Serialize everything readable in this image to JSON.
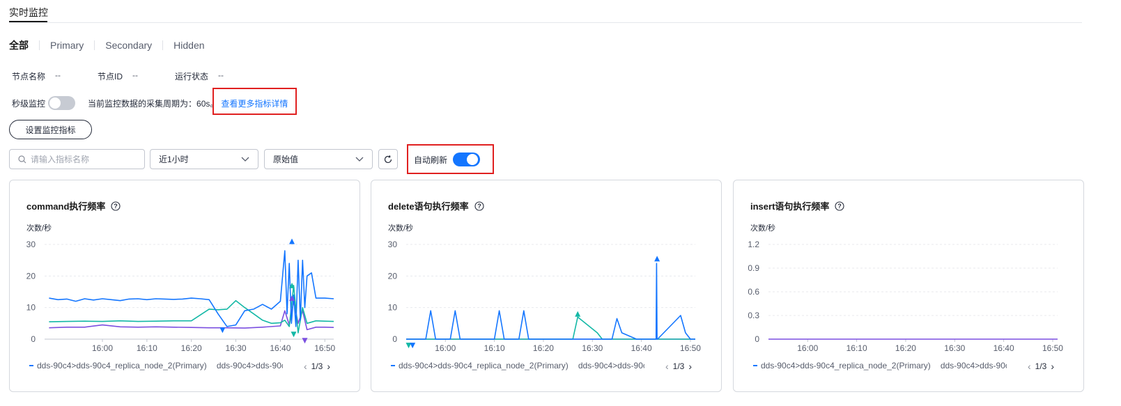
{
  "page": {
    "tab_label": "实时监控"
  },
  "role_tabs": [
    "全部",
    "Primary",
    "Secondary",
    "Hidden"
  ],
  "node_info": [
    {
      "label": "节点名称",
      "value": "--"
    },
    {
      "label": "节点ID",
      "value": "--"
    },
    {
      "label": "运行状态",
      "value": "--"
    }
  ],
  "second_monitor": {
    "label": "秒级监控",
    "enabled": false,
    "desc": "当前监控数据的采集周期为：60s。",
    "link": "查看更多指标详情"
  },
  "toolbar": {
    "setting_button": "设置监控指标",
    "search_placeholder": "请输入指标名称",
    "time_range": "近1小时",
    "value_type": "原始值",
    "auto_refresh_label": "自动刷新",
    "auto_refresh_enabled": true
  },
  "icons": {
    "search": "search-icon",
    "chevron": "chevron-down-icon",
    "refresh": "refresh-icon",
    "help": "help-circle-icon"
  },
  "colors": {
    "accent": "#1476ff",
    "series1": "#1476ff",
    "series2": "#14b8a6",
    "series3": "#7b4fe0"
  },
  "legend": {
    "series1": "dds-90c4>dds-90c4_replica_node_2(Primary)",
    "series2": "dds-90c4>dds-90c",
    "page": "1/3"
  },
  "cards": [
    {
      "title": "command执行频率",
      "unit": "次数/秒",
      "chart_data": {
        "type": "line",
        "x_ticks": [
          "16:00",
          "16:10",
          "16:20",
          "16:30",
          "16:40",
          "16:50"
        ],
        "y_ticks": [
          "30",
          "20",
          "10",
          "0"
        ],
        "ylim": [
          0,
          30
        ],
        "xlim": [
          -13,
          52
        ],
        "series": [
          {
            "name": "dds-90c4>dds-90c4_replica_node_2(Primary)",
            "color": "#1476ff",
            "x": [
              -12,
              -10,
              -8,
              -6,
              -4,
              -2,
              0,
              2,
              4,
              6,
              8,
              10,
              12,
              14,
              16,
              18,
              20,
              22,
              24,
              26,
              28,
              30,
              32,
              34,
              36,
              38,
              40,
              41,
              41.5,
              42,
              42.5,
              43,
              43.5,
              44,
              44.5,
              45,
              45.5,
              46,
              47,
              48,
              50,
              52
            ],
            "y": [
              13,
              12.5,
              12.7,
              12,
              12.8,
              12.4,
              12.8,
              12.5,
              12.2,
              12.7,
              12.8,
              12.5,
              12.8,
              12.7,
              12.6,
              12.7,
              13,
              12.8,
              12.5,
              8,
              4,
              4.5,
              9,
              9.5,
              11,
              9.5,
              12,
              28,
              8,
              24,
              5,
              14,
              4,
              25,
              6,
              25,
              10,
              20,
              21,
              13,
              13,
              12.8
            ]
          },
          {
            "name": "dds-90c4>dds-90c",
            "color": "#14b8a6",
            "x": [
              -12,
              -8,
              -4,
              0,
              4,
              8,
              12,
              16,
              20,
              24,
              26,
              28,
              30,
              32,
              34,
              36,
              38,
              40,
              41,
              42,
              43,
              44,
              45,
              46,
              48,
              50,
              52
            ],
            "y": [
              5.5,
              5.6,
              5.7,
              5.6,
              5.8,
              5.6,
              5.7,
              5.8,
              5.8,
              9.5,
              9.3,
              9.5,
              12.2,
              10,
              8,
              6,
              5,
              5.2,
              6,
              4,
              17,
              2,
              10,
              5,
              5.8,
              5.7,
              5.6
            ]
          },
          {
            "name": "series3",
            "color": "#7b4fe0",
            "x": [
              -12,
              -8,
              -4,
              0,
              4,
              8,
              12,
              16,
              20,
              24,
              28,
              32,
              36,
              40,
              41,
              42,
              43,
              44,
              45,
              46,
              48,
              50,
              52
            ],
            "y": [
              3.6,
              3.8,
              3.8,
              4.5,
              3.9,
              3.8,
              3.9,
              3.8,
              3.7,
              3.6,
              3.6,
              3.5,
              3.8,
              4.2,
              9,
              4.5,
              12,
              5,
              9,
              3,
              3.8,
              3.8,
              3.7
            ]
          }
        ],
        "markers": [
          {
            "x": 42.6,
            "y": 31,
            "dir": "up",
            "color": "#1476ff"
          },
          {
            "x": 42.6,
            "y": 17,
            "dir": "up",
            "color": "#14b8a6"
          },
          {
            "x": 42.6,
            "y": 13,
            "dir": "up",
            "color": "#7b4fe0"
          },
          {
            "x": 27,
            "y": 2.8,
            "dir": "down",
            "color": "#1476ff"
          },
          {
            "x": 43,
            "y": 1.5,
            "dir": "down",
            "color": "#14b8a6"
          },
          {
            "x": 45.5,
            "y": -0.5,
            "dir": "down",
            "color": "#7b4fe0"
          }
        ]
      }
    },
    {
      "title": "delete语句执行频率",
      "unit": "次数/秒",
      "chart_data": {
        "type": "line",
        "x_ticks": [
          "16:00",
          "16:10",
          "16:20",
          "16:30",
          "16:40",
          "16:50"
        ],
        "y_ticks": [
          "30",
          "20",
          "10",
          "0"
        ],
        "ylim": [
          0,
          30
        ],
        "xlim": [
          -8,
          51
        ],
        "series": [
          {
            "name": "dds-90c4>dds-90c4_replica_node_2(Primary)",
            "color": "#1476ff",
            "x": [
              -8,
              -4,
              -3,
              -2,
              1,
              2,
              3,
              10,
              11,
              12,
              15,
              16,
              17,
              34,
              35,
              36,
              39,
              40,
              41,
              42,
              43,
              43.1,
              43.2,
              43.3,
              48,
              49,
              50,
              51
            ],
            "y": [
              0,
              0,
              9,
              0,
              0,
              9,
              0,
              0,
              9,
              0,
              0,
              9,
              0,
              0,
              6.5,
              2,
              0,
              0,
              0,
              0,
              0,
              24,
              0,
              0,
              7.5,
              2,
              0,
              0
            ]
          },
          {
            "name": "dds-90c",
            "color": "#14b8a6",
            "x": [
              -8,
              26,
              27,
              31,
              32,
              51
            ],
            "y": [
              0,
              0,
              7,
              2,
              0,
              0
            ]
          },
          {
            "name": "series3",
            "color": "#7b4fe0",
            "x": [
              -8,
              51
            ],
            "y": [
              0,
              0
            ]
          }
        ],
        "markers": [
          {
            "x": 43.2,
            "y": 25.5,
            "dir": "up",
            "color": "#1476ff"
          },
          {
            "x": 27,
            "y": 8,
            "dir": "up",
            "color": "#14b8a6"
          },
          {
            "x": -7.5,
            "y": -2,
            "dir": "down",
            "color": "#14b8a6"
          },
          {
            "x": -6.7,
            "y": -2,
            "dir": "down",
            "color": "#1476ff"
          }
        ]
      }
    },
    {
      "title": "insert语句执行频率",
      "unit": "次数/秒",
      "chart_data": {
        "type": "line",
        "x_ticks": [
          "16:00",
          "16:10",
          "16:20",
          "16:30",
          "16:40",
          "16:50"
        ],
        "y_ticks": [
          "1.2",
          "0.9",
          "0.6",
          "0.3",
          "0"
        ],
        "ylim": [
          0,
          1.2
        ],
        "xlim": [
          -8,
          51
        ],
        "series": [
          {
            "name": "dds-90c4>dds-90c4_replica_node_2(Primary)",
            "color": "#7b4fe0",
            "x": [
              -8,
              51
            ],
            "y": [
              0,
              0
            ]
          }
        ],
        "markers": []
      }
    }
  ]
}
